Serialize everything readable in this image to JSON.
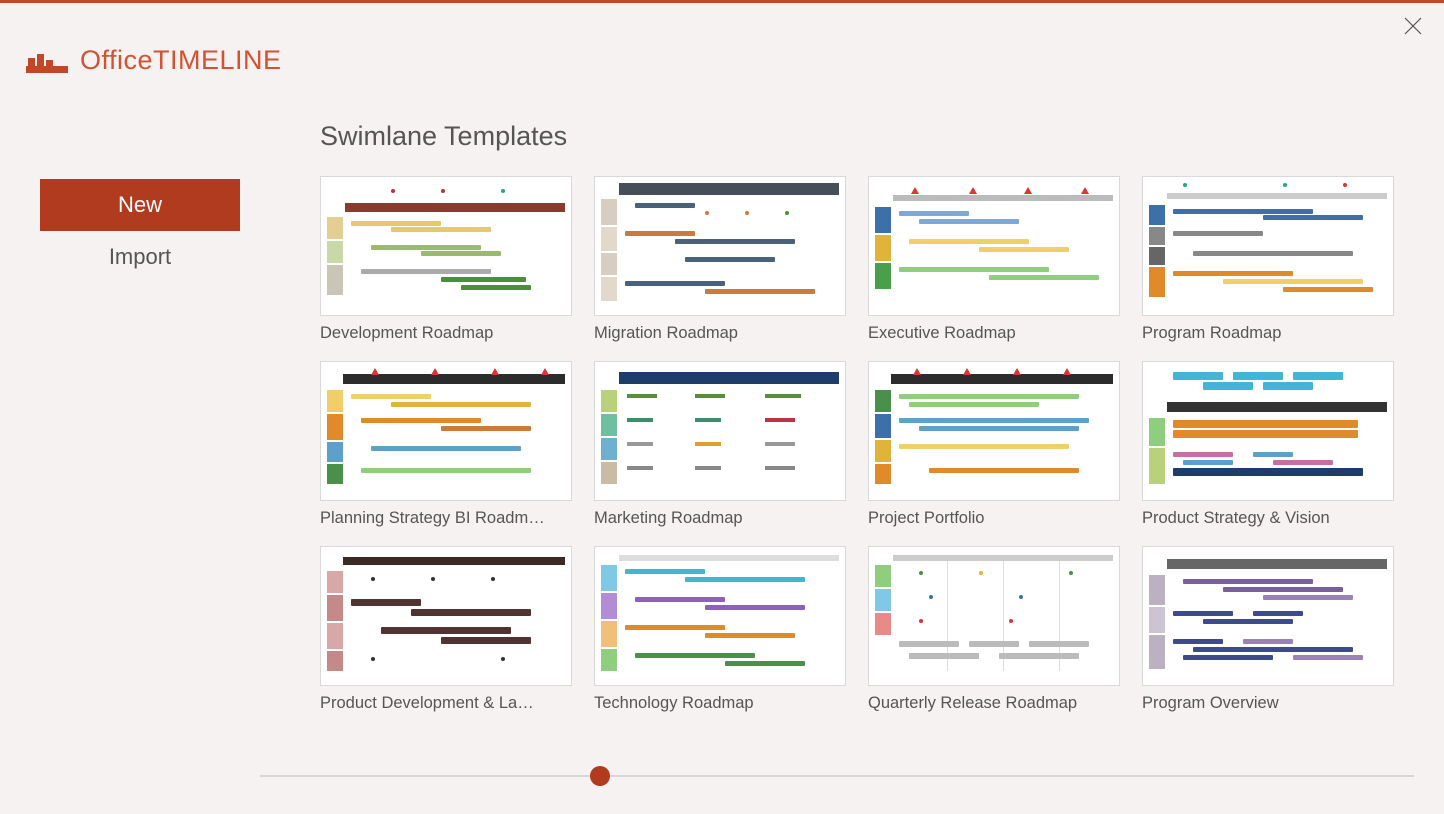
{
  "brand": {
    "name_light": "Office",
    "name_bold": "TIMELINE"
  },
  "sidebar": {
    "items": [
      {
        "label": "New",
        "active": true
      },
      {
        "label": "Import",
        "active": false
      }
    ]
  },
  "page": {
    "title": "Swimlane Templates"
  },
  "templates": [
    {
      "label": "Development Roadmap"
    },
    {
      "label": "Migration Roadmap"
    },
    {
      "label": "Executive Roadmap"
    },
    {
      "label": "Program Roadmap"
    },
    {
      "label": "Planning Strategy BI Roadm…"
    },
    {
      "label": "Marketing Roadmap"
    },
    {
      "label": "Project Portfolio"
    },
    {
      "label": "Product Strategy & Vision"
    },
    {
      "label": "Product Development & La…"
    },
    {
      "label": "Technology Roadmap"
    },
    {
      "label": "Quarterly Release Roadmap"
    },
    {
      "label": "Program Overview"
    }
  ]
}
